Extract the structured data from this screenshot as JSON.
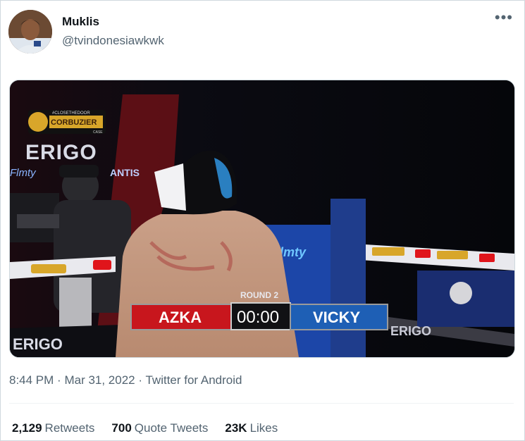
{
  "tweet": {
    "author_name": "Muklis",
    "author_handle": "@tvindonesiawkwk",
    "more_label": "•••",
    "time": "8:44 PM",
    "date": "Mar 31, 2022",
    "source": "Twitter for Android",
    "separator": "·"
  },
  "media": {
    "sponsor_top": "#CLOSETHEDOOR",
    "sponsor_brand": "CORBUZIER",
    "sponsor_sub": "CASE",
    "banner_main": "ERIGO",
    "banner_left_1": "Flmty",
    "banner_left_2": "ANTIS",
    "corner_post_label": "Flmty",
    "banner_bottom_left": "ERIGO",
    "banner_bottom_right": "ERIGO",
    "round_label": "ROUND 2",
    "fighter_left": "AZKA",
    "timer": "00:00",
    "fighter_right": "VICKY",
    "colors": {
      "left_corner": "#c8161d",
      "right_corner": "#1e5fb5",
      "post_blue": "#1c46a8"
    }
  },
  "stats": {
    "retweets_count": "2,129",
    "retweets_label": "Retweets",
    "quotes_count": "700",
    "quotes_label": "Quote Tweets",
    "likes_count": "23K",
    "likes_label": "Likes"
  }
}
